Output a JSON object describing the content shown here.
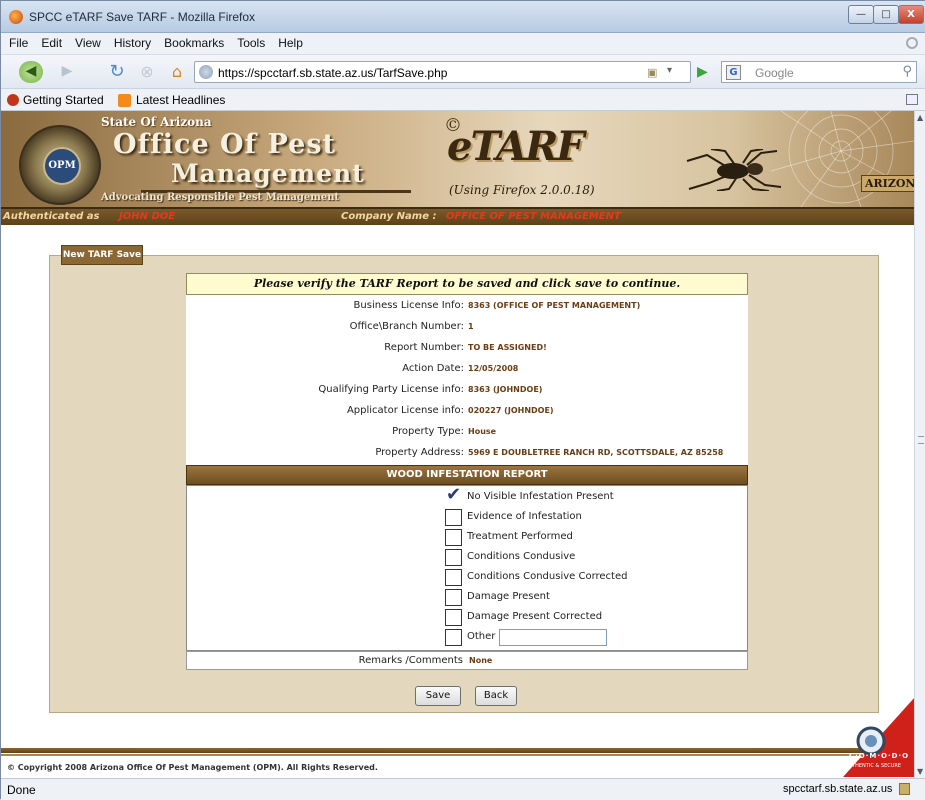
{
  "window": {
    "title": "SPCC eTARF Save TARF - Mozilla Firefox",
    "min_glyph": "—",
    "max_glyph": "□",
    "close_glyph": "X"
  },
  "menu": [
    "File",
    "Edit",
    "View",
    "History",
    "Bookmarks",
    "Tools",
    "Help"
  ],
  "nav": {
    "url": "https://spcctarf.sb.state.az.us/TarfSave.php",
    "search_engine": "G",
    "search_placeholder": "Google",
    "back_glyph": "◀",
    "forward_glyph": "▶",
    "reload_glyph": "↻",
    "stop_glyph": "⊗",
    "home_glyph": "⌂",
    "go_glyph": "▶",
    "search_go_glyph": "⚲",
    "dropdown_glyph": "▾"
  },
  "bookmarks": [
    "Getting Started",
    "Latest Headlines"
  ],
  "banner": {
    "state": "State Of Arizona",
    "title_line1": "Office Of Pest",
    "title_line2": "Management",
    "slogan": "Advocating Responsible Pest Management",
    "seal_text": "OPM",
    "etarf_copyright": "©",
    "etarf_word": "eTARF",
    "firefox_note": "(Using Firefox 2.0.0.18)",
    "badge": "ARIZONA"
  },
  "auth": {
    "label": "Authenticated as",
    "user": "JOHN DOE",
    "company_label": "Company Name :",
    "company": "OFFICE OF PEST MANAGEMENT"
  },
  "panel": {
    "tab_label": "New TARF Save",
    "verify_text": "Please verify the TARF Report to be saved and click save to continue."
  },
  "report": [
    {
      "label": "Business License Info:",
      "value": "8363 (OFFICE OF PEST MANAGEMENT)"
    },
    {
      "label": "Office\\Branch Number:",
      "value": "1"
    },
    {
      "label": "Report Number:",
      "value": "TO BE ASSIGNED!"
    },
    {
      "label": "Action Date:",
      "value": "12/05/2008"
    },
    {
      "label": "Qualifying Party License info:",
      "value": "8363 (JOHNDOE)"
    },
    {
      "label": "Applicator License info:",
      "value": "020227 (JOHNDOE)"
    },
    {
      "label": "Property Type:",
      "value": "House"
    },
    {
      "label": "Property Address:",
      "value": "5969 E DOUBLETREE RANCH RD, SCOTTSDALE, AZ 85258"
    }
  ],
  "wood_header": "WOOD INFESTATION REPORT",
  "checkboxes": [
    {
      "label": "No Visible Infestation Present",
      "checked": true
    },
    {
      "label": "Evidence of Infestation",
      "checked": false
    },
    {
      "label": "Treatment Performed",
      "checked": false
    },
    {
      "label": "Conditions Condusive",
      "checked": false
    },
    {
      "label": "Conditions Condusive Corrected",
      "checked": false
    },
    {
      "label": "Damage Present",
      "checked": false
    },
    {
      "label": "Damage Present Corrected",
      "checked": false
    },
    {
      "label": "Other",
      "checked": false
    }
  ],
  "check_mark": "✔",
  "remarks": {
    "label": "Remarks /Comments",
    "value": "None"
  },
  "buttons": {
    "save": "Save",
    "back": "Back"
  },
  "footer": {
    "copyright": "© Copyright 2008 Arizona Office Of Pest Management (OPM). All Rights Reserved.",
    "comodo": "C·O·M·O·D·O",
    "comodo_sub": "AUTHENTIC & SECURE"
  },
  "status": {
    "text": "Done",
    "domain": "spcctarf.sb.state.az.us"
  },
  "scroll": {
    "up_glyph": "▲",
    "down_glyph": "▼"
  },
  "colors": {
    "brand_brown": "#6e4e20",
    "panel_bg": "#e3d8bd",
    "value_text": "#6b3d14",
    "highlight_red": "#e23a1c"
  }
}
